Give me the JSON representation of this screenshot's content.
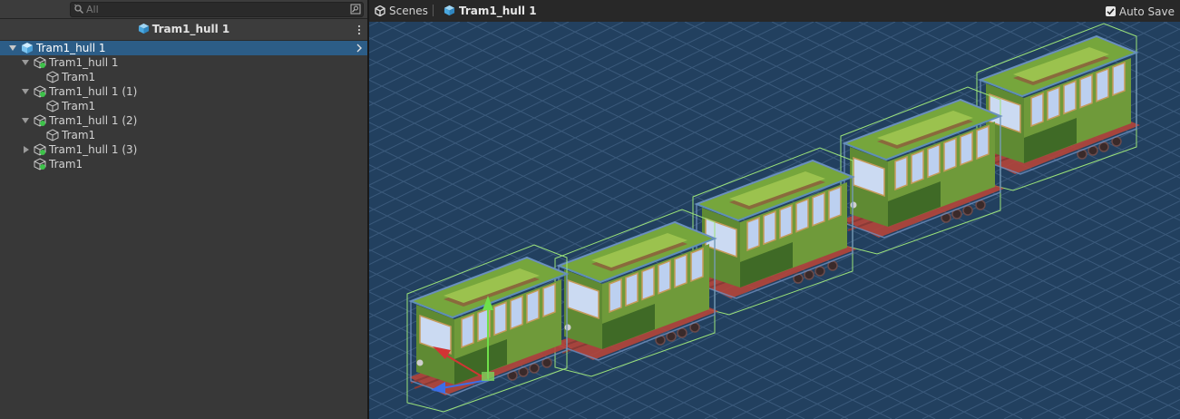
{
  "search": {
    "placeholder": "All"
  },
  "hierarchy": {
    "title": "Tram1_hull 1",
    "rows": [
      {
        "label": "Tram1_hull 1"
      },
      {
        "label": "Tram1_hull 1"
      },
      {
        "label": "Tram1"
      },
      {
        "label": "Tram1_hull 1 (1)"
      },
      {
        "label": "Tram1"
      },
      {
        "label": "Tram1_hull 1 (2)"
      },
      {
        "label": "Tram1"
      },
      {
        "label": "Tram1_hull 1 (3)"
      },
      {
        "label": "Tram1"
      }
    ]
  },
  "scene": {
    "breadcrumbs": [
      "Scenes",
      "Tram1_hull 1"
    ],
    "auto_save_label": "Auto Save",
    "auto_save_checked": true
  },
  "colors": {
    "selection": "#2c5d87",
    "grid_background": "#22405f",
    "tram_body": "#6f9a3a",
    "tram_roof": "#76a63c",
    "bounds_green": "#9be37a",
    "gizmo_x": "#d23434",
    "gizmo_y": "#6fe04a",
    "gizmo_z": "#3b6ee8"
  }
}
